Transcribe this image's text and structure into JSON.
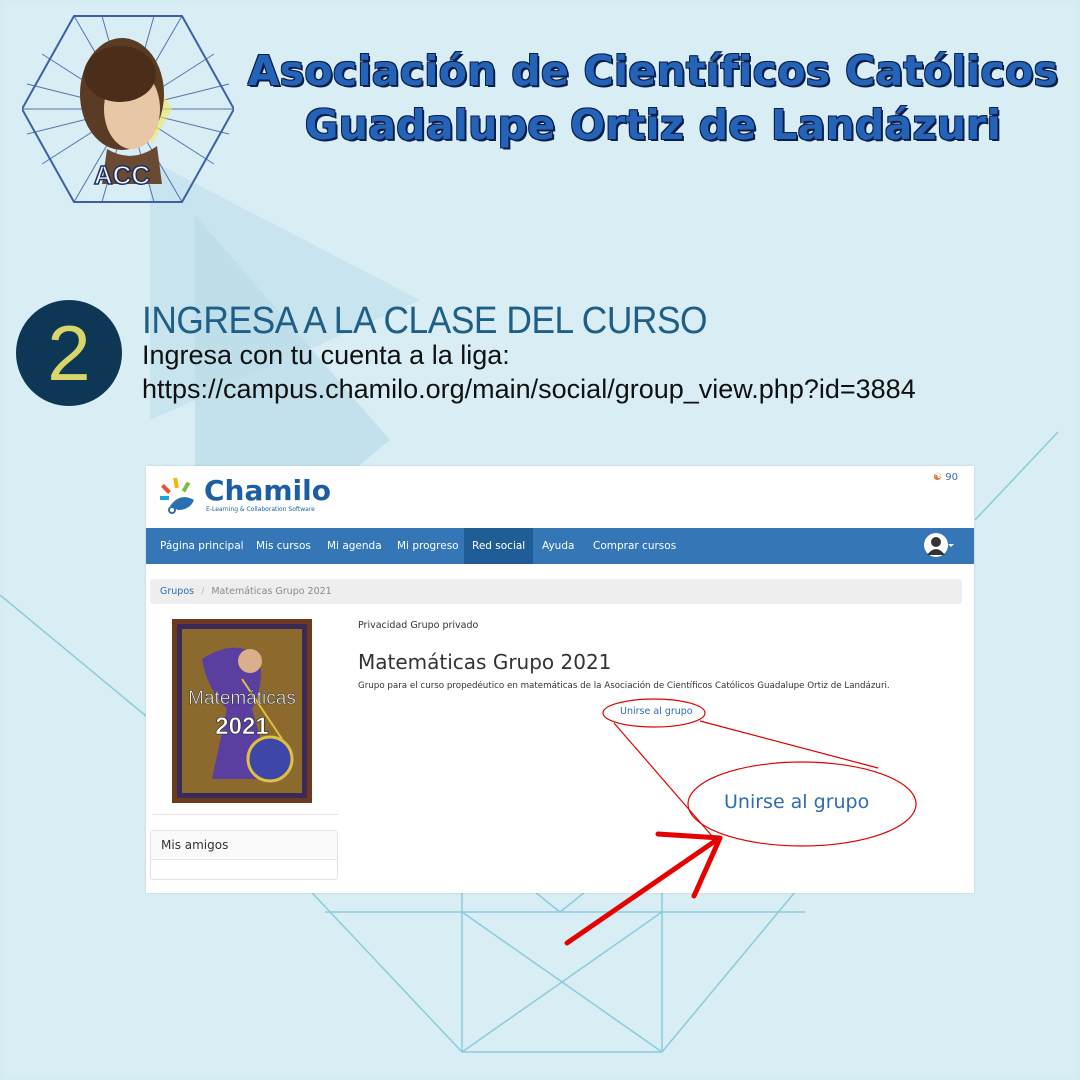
{
  "header": {
    "title_line1": "Asociación de Científicos Católicos",
    "title_line2": "Guadalupe Ortiz de Landázuri",
    "logo_text": "ACC"
  },
  "step": {
    "number": "2",
    "heading": "INGRESA A LA CLASE DEL CURSO",
    "line1": "Ingresa con tu cuenta a la liga:",
    "url": "https://campus.chamilo.org/main/social/group_view.php?id=3884"
  },
  "screenshot": {
    "brand_name": "Chamilo",
    "brand_tagline": "E-Learning & Collaboration Software",
    "user_count": "90",
    "nav": [
      {
        "label": "Página principal",
        "active": false
      },
      {
        "label": "Mis cursos",
        "active": false
      },
      {
        "label": "Mi agenda",
        "active": false
      },
      {
        "label": "Mi progreso",
        "active": false
      },
      {
        "label": "Red social",
        "active": true
      },
      {
        "label": "Ayuda",
        "active": false
      },
      {
        "label": "Comprar cursos",
        "active": false
      }
    ],
    "breadcrumb": {
      "root": "Grupos",
      "separator": "/",
      "current": "Matemáticas Grupo 2021"
    },
    "cover": {
      "line1": "Matemáticas",
      "line2": "2021"
    },
    "privacy_text": "Privacidad Grupo privado",
    "group_title": "Matemáticas Grupo 2021",
    "group_description": "Grupo para el curso propedéutico en matemáticas de la Asociación de Científicos Católicos Guadalupe Ortiz de Landázuri.",
    "join_link": "Unirse al grupo",
    "join_zoom": "Unirse al grupo",
    "friends_title": "Mis amigos"
  },
  "colors": {
    "background": "#d8edf4",
    "title": "#2563b8",
    "step_circle": "#0e3756",
    "step_number": "#d8d56a",
    "navbar": "#3476b6",
    "navbar_active": "#205d96",
    "annotation": "#e00000"
  }
}
